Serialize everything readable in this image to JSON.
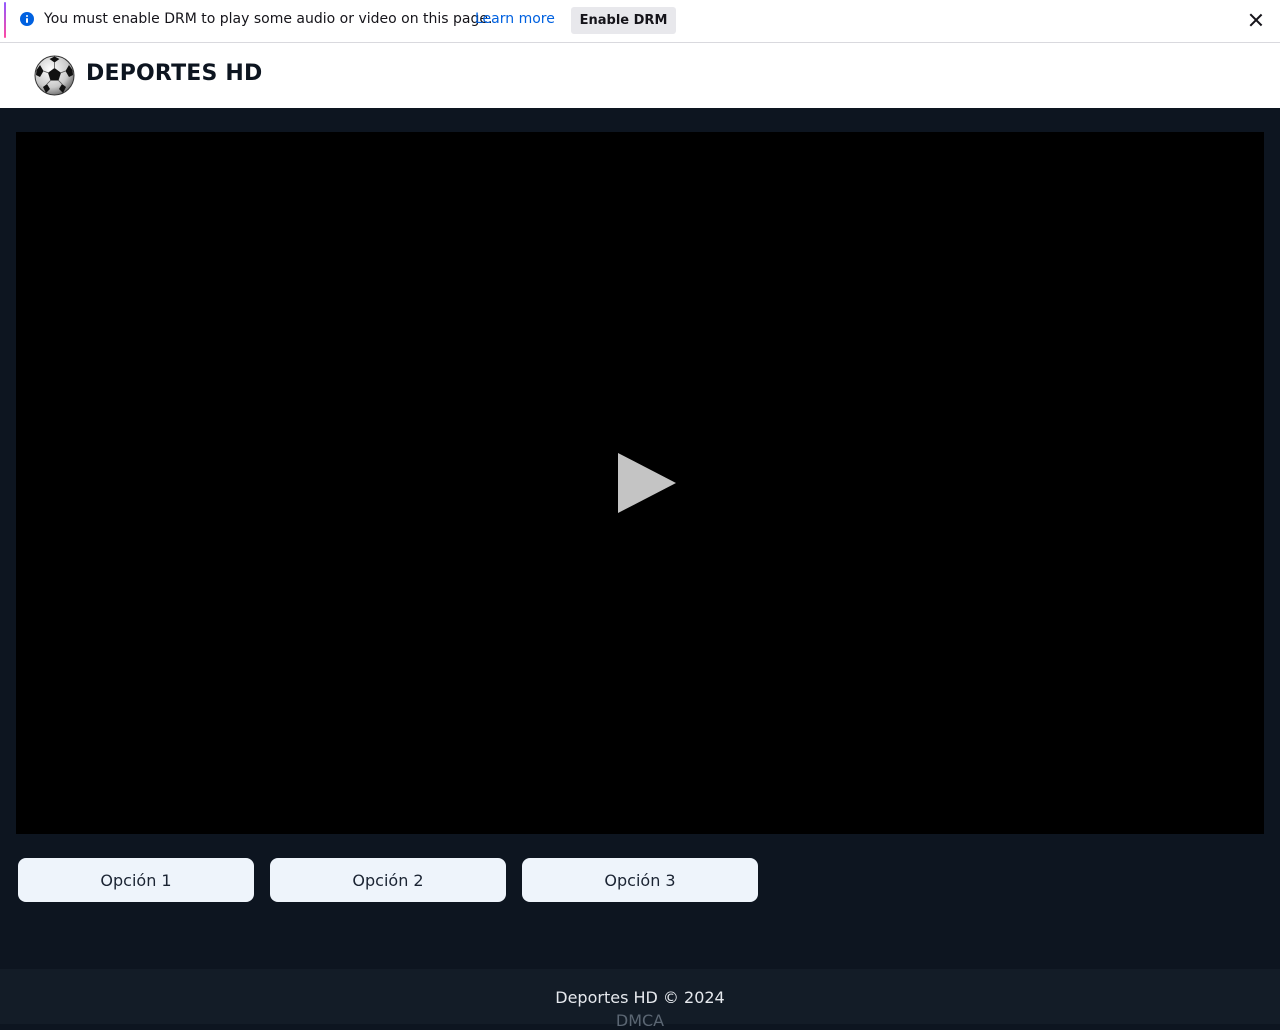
{
  "notification": {
    "icon": "info-icon",
    "message": "You must enable DRM to play some audio or video on this page.",
    "learn_more": "Learn more",
    "enable_button": "Enable DRM",
    "close_icon": "close-icon",
    "accent_color": "#0061e0"
  },
  "header": {
    "logo": "soccer-ball-icon",
    "title": "DEPORTES HD"
  },
  "player": {
    "play_icon": "play-icon"
  },
  "options": [
    {
      "label": "Opción 1"
    },
    {
      "label": "Opción 2"
    },
    {
      "label": "Opción 3"
    }
  ],
  "footer": {
    "copyright": "Deportes HD © 2024",
    "dmca": "DMCA"
  },
  "colors": {
    "page_background": "#0d1520",
    "player_background": "#000000",
    "option_background": "#eef4fb",
    "footer_background": "#131c27"
  }
}
